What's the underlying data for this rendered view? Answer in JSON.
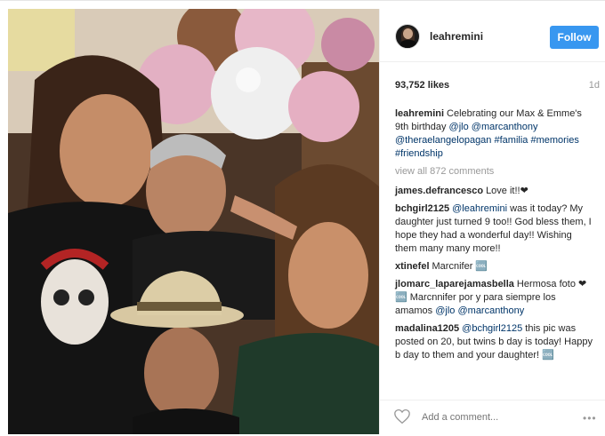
{
  "post": {
    "username": "leahremini",
    "follow_label": "Follow",
    "likes": "93,752 likes",
    "age": "1d",
    "caption": {
      "username": "leahremini",
      "text": "Celebrating our Max & Emme's 9th birthday",
      "tags": [
        "@jlo",
        "@marcanthony",
        "@theraelangelopagan",
        "#familia",
        "#memories",
        "#friendship"
      ]
    },
    "view_all": "view all 872 comments",
    "comments": [
      {
        "user": "james.defrancesco",
        "text": "Love it!!❤"
      },
      {
        "user": "bchgirl2125",
        "mention": "@leahremini",
        "text": "was it today? My daughter just turned 9 too!! God bless them, I hope they had a wonderful day!! Wishing them many many more!!"
      },
      {
        "user": "xtinefel",
        "text": "Marcnifer 🆒"
      },
      {
        "user": "jlomarc_laparejamasbella",
        "text_a": "Hermosa foto ❤🆒 Marcnnifer por y para siempre los amamos",
        "mentions": [
          "@jlo",
          "@marcanthony"
        ]
      },
      {
        "user": "madalina1205",
        "mention": "@bchgirl2125",
        "text": "this pic was posted on 20, but twins b   day is today! Happy b   day to them and your daughter! 🆒"
      }
    ],
    "add_comment_placeholder": "Add a comment...",
    "more_icon": "ellipsis-icon",
    "heart_icon": "heart-icon",
    "colors": {
      "follow": "#3897f0",
      "link": "#003569",
      "muted": "#999999"
    }
  }
}
